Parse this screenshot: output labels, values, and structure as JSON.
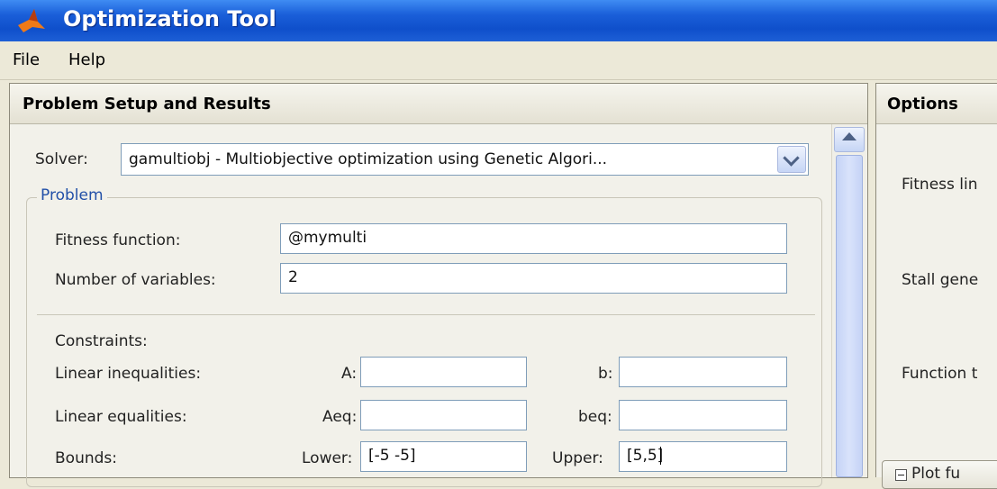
{
  "window": {
    "title": "Optimization Tool"
  },
  "menu": {
    "items": [
      "File",
      "Help"
    ]
  },
  "problem_panel": {
    "header": "Problem Setup and Results",
    "solver_label": "Solver:",
    "solver_value": "gamultiobj - Multiobjective optimization using Genetic Algori...",
    "group_title": "Problem",
    "fitness_label": "Fitness function:",
    "fitness_value": "@mymulti",
    "numvars_label": "Number of variables:",
    "numvars_value": "2",
    "constraints_label": "Constraints:",
    "lin_ineq_label": "Linear inequalities:",
    "a_label": "A:",
    "a_value": "",
    "b_label": "b:",
    "b_value": "",
    "lin_eq_label": "Linear equalities:",
    "aeq_label": "Aeq:",
    "aeq_value": "",
    "beq_label": "beq:",
    "beq_value": "",
    "bounds_label": "Bounds:",
    "lower_label": "Lower:",
    "lower_value": "[-5 -5]",
    "upper_label": "Upper:",
    "upper_value": "[5,5]"
  },
  "options_panel": {
    "header": "Options",
    "items": [
      "Fitness lin",
      "Stall gene",
      "Function t"
    ],
    "plot_tab": "Plot fu"
  },
  "colors": {
    "titlebar": "#0f4fcb",
    "group_title": "#2250a8",
    "field_border": "#7f9db9"
  }
}
